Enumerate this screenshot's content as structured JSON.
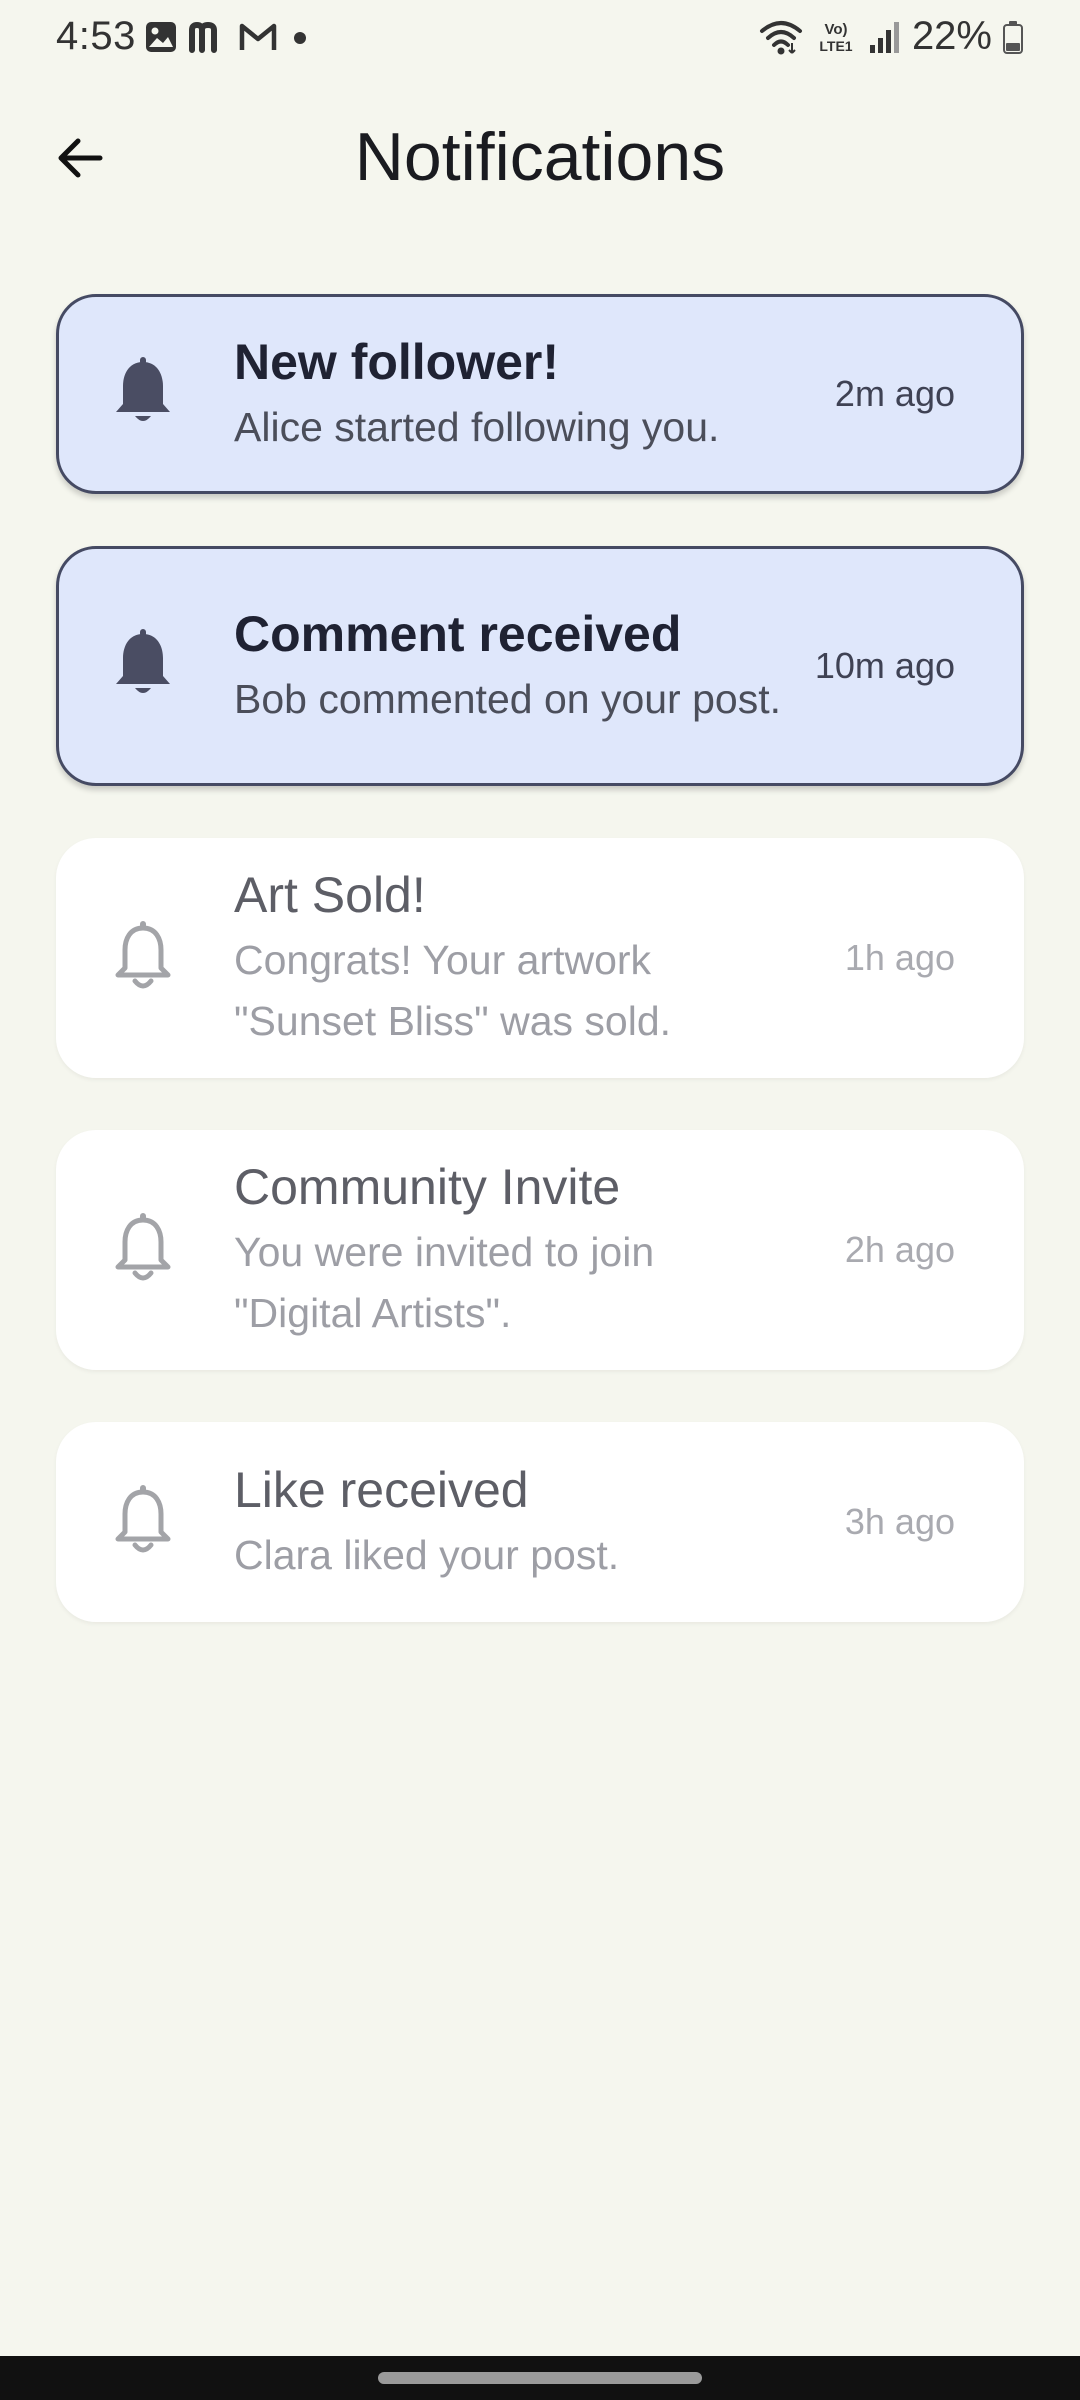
{
  "status_bar": {
    "time": "4:53",
    "battery_percent": "22%",
    "network_label": "Vo) LTE1",
    "left_icons": [
      "gallery-icon",
      "m-app-icon",
      "gmail-icon",
      "dot-icon"
    ],
    "right_icons": [
      "wifi-icon",
      "lte-icon",
      "signal-icon",
      "battery-icon"
    ]
  },
  "app_bar": {
    "title": "Notifications",
    "back_icon": "arrow-left-icon"
  },
  "notifications": [
    {
      "title": "New follower!",
      "body": "Alice started following you.",
      "time": "2m ago",
      "unread": true,
      "icon": "bell-filled-icon"
    },
    {
      "title": "Comment received",
      "body": "Bob commented on your post.",
      "time": "10m ago",
      "unread": true,
      "icon": "bell-filled-icon"
    },
    {
      "title": "Art Sold!",
      "body": "Congrats! Your artwork \"Sunset Bliss\" was sold.",
      "time": "1h ago",
      "unread": false,
      "icon": "bell-outline-icon"
    },
    {
      "title": "Community Invite",
      "body": "You were invited to join \"Digital Artists\".",
      "time": "2h ago",
      "unread": false,
      "icon": "bell-outline-icon"
    },
    {
      "title": "Like received",
      "body": "Clara liked your post.",
      "time": "3h ago",
      "unread": false,
      "icon": "bell-outline-icon"
    }
  ],
  "colors": {
    "background": "#f5f6ee",
    "unread_card": "#dfe7fb",
    "unread_border": "#454a63",
    "read_card": "#ffffff",
    "unread_icon": "#4a4d63",
    "read_icon": "#a3a4a8"
  }
}
